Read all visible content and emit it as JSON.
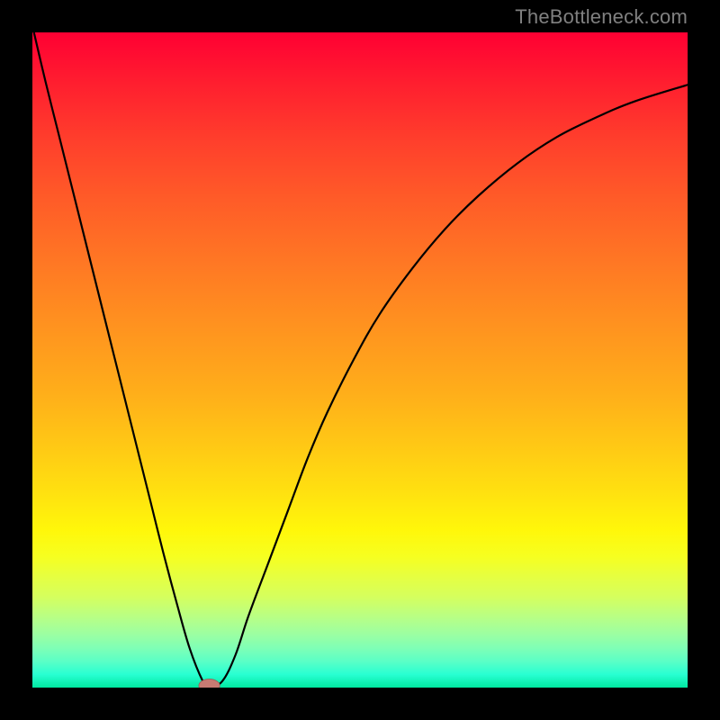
{
  "watermark": "TheBottleneck.com",
  "colors": {
    "frame_bg": "#000000",
    "curve": "#000000",
    "marker_fill": "#c77b73",
    "marker_stroke": "#9c5e58"
  },
  "chart_data": {
    "type": "line",
    "title": "",
    "xlabel": "",
    "ylabel": "",
    "xlim": [
      0,
      100
    ],
    "ylim": [
      0,
      100
    ],
    "grid": false,
    "x": [
      0,
      2,
      4,
      6,
      8,
      10,
      12,
      14,
      16,
      18,
      20,
      22,
      24,
      26,
      27,
      29,
      31,
      33,
      36,
      39,
      42,
      45,
      49,
      53,
      58,
      63,
      68,
      74,
      80,
      86,
      92,
      100
    ],
    "series": [
      {
        "name": "bottleneck_curve",
        "values": [
          101,
          92.5,
          84.5,
          76.5,
          68.5,
          60.5,
          52.5,
          44.5,
          36.5,
          28.5,
          20.5,
          13,
          6,
          1,
          0,
          1,
          5,
          11,
          19,
          27,
          35,
          42,
          50,
          57,
          64,
          70,
          75,
          80,
          84,
          87,
          89.5,
          92
        ]
      }
    ],
    "marker": {
      "x": 27,
      "y": 0.3,
      "rx": 1.6,
      "ry": 1.0
    },
    "curve_stroke_width": 2.2
  }
}
